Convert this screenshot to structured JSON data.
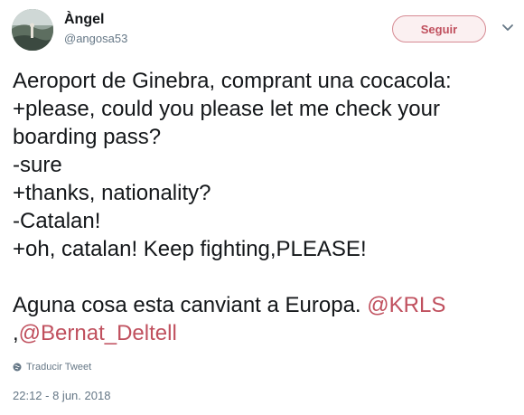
{
  "user": {
    "name": "Àngel",
    "handle": "@angosa53"
  },
  "follow_button": {
    "label": "Seguir"
  },
  "tweet": {
    "lines": [
      "Aeroport de Ginebra, comprant una cocacola:",
      "+please, could you please let me check your",
      "boarding pass?",
      "-sure",
      "+thanks, nationality?",
      "-Catalan!",
      "+oh, catalan! Keep fighting,PLEASE!",
      "",
      "Aguna cosa esta canviant a Europa. "
    ],
    "mention_1": "@KRLS",
    "line_prefix_2": ",",
    "mention_2": "@Bernat_Deltell"
  },
  "translate_label": "Traducir Tweet",
  "timestamp": "22:12 - 8 jun. 2018",
  "colors": {
    "accent": "#c0505e",
    "text": "#14171a",
    "muted": "#657786"
  },
  "icons": {
    "caret": "chevron-down-icon",
    "globe": "globe-icon"
  }
}
